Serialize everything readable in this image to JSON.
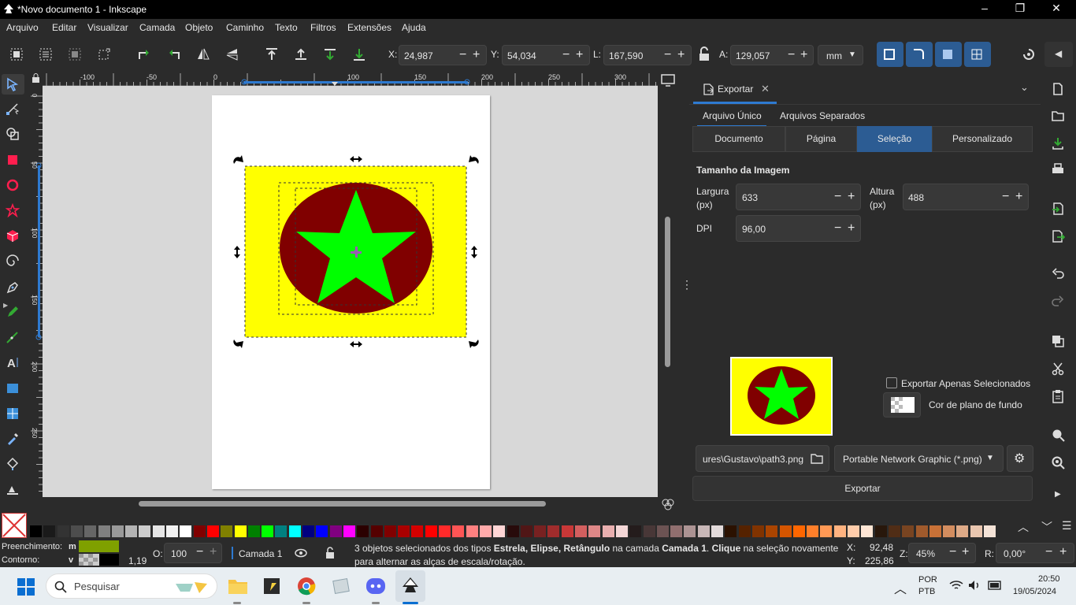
{
  "window": {
    "title": "*Novo documento 1 - Inkscape"
  },
  "menu": [
    "Arquivo",
    "Editar",
    "Visualizar",
    "Camada",
    "Objeto",
    "Caminho",
    "Texto",
    "Filtros",
    "Extensões",
    "Ajuda"
  ],
  "toolbar": {
    "x_label": "X:",
    "x_value": "24,987",
    "y_label": "Y:",
    "y_value": "54,034",
    "w_label": "L:",
    "w_value": "167,590",
    "h_label": "A:",
    "h_value": "129,057",
    "unit": "mm"
  },
  "rulers": {
    "h_ticks": [
      "-100",
      "-50",
      "0",
      "50",
      "100",
      "150",
      "200",
      "250",
      "300"
    ],
    "v_ticks": [
      "0",
      "50",
      "100",
      "150",
      "200",
      "250"
    ]
  },
  "export_panel": {
    "tab_title": "Exportar",
    "subtabs": [
      "Arquivo Único",
      "Arquivos Separados"
    ],
    "modes": [
      "Documento",
      "Página",
      "Seleção",
      "Personalizado"
    ],
    "active_mode": "Seleção",
    "section_title": "Tamanho da Imagem",
    "width_label": "Largura (px)",
    "width_value": "633",
    "height_label": "Altura (px)",
    "height_value": "488",
    "dpi_label": "DPI",
    "dpi_value": "96,00",
    "only_selected_label": "Exportar Apenas Selecionados",
    "bg_color_label": "Cor de plano de fundo",
    "filename": "ures\\Gustavo\\path3.png",
    "format": "Portable Network Graphic (*.png)",
    "export_button": "Exportar"
  },
  "colors": {
    "rect_fill": "#ffff00",
    "ellipse_fill": "#800000",
    "star_fill": "#00ff00",
    "accent": "#2c5c93"
  },
  "palette": [
    "#000000",
    "#1a1a1a",
    "#333333",
    "#4d4d4d",
    "#666666",
    "#808080",
    "#999999",
    "#b3b3b3",
    "#cccccc",
    "#e6e6e6",
    "#f2f2f2",
    "#ffffff",
    "#800000",
    "#ff0000",
    "#808000",
    "#ffff00",
    "#008000",
    "#00ff00",
    "#008080",
    "#00ffff",
    "#000080",
    "#0000ff",
    "#800080",
    "#ff00ff",
    "#2b0000",
    "#550000",
    "#800000",
    "#aa0000",
    "#d40000",
    "#ff0000",
    "#ff2a2a",
    "#ff5555",
    "#ff8080",
    "#ffaaaa",
    "#ffd5d5",
    "#280b0b",
    "#501616",
    "#782121",
    "#a02c2c",
    "#c83737",
    "#d35f5f",
    "#de8787",
    "#e9afaf",
    "#f4d7d7",
    "#241c1c",
    "#483737",
    "#6c5353",
    "#916f6f",
    "#ac9393",
    "#c8b7b7",
    "#e3dbdb",
    "#2b1100",
    "#552200",
    "#803300",
    "#aa4400",
    "#d45500",
    "#ff6600",
    "#ff7f2a",
    "#ff9955",
    "#ffb380",
    "#ffccaa",
    "#ffe6d5",
    "#28170b",
    "#502d16",
    "#784421",
    "#a05a2c",
    "#c87137",
    "#d38d5f",
    "#deaa87",
    "#e9c6af",
    "#f4e3d7"
  ],
  "status": {
    "fill_label": "Preenchimento:",
    "fill_code": "m",
    "stroke_label": "Contorno:",
    "stroke_code": "v",
    "stroke_width": "1,19",
    "opacity_label": "O:",
    "opacity_value": "100",
    "layer": "Camada 1",
    "message_a": "3 objetos selecionados dos tipos ",
    "message_b": "Estrela, Elipse, Retângulo",
    "message_c": " na camada ",
    "message_d": "Camada 1",
    "message_e": ". ",
    "message_f": "Clique",
    "message_g": " na seleção novamente para alternar as alças de escala/rotação.",
    "cursor_x_label": "X:",
    "cursor_x": "92,48",
    "cursor_y_label": "Y:",
    "cursor_y": "225,86",
    "zoom_label": "Z:",
    "zoom_value": "45%",
    "rotation_label": "R:",
    "rotation_value": "0,00°",
    "fill_color": "#7fa000"
  },
  "taskbar": {
    "search_placeholder": "Pesquisar",
    "lang1": "POR",
    "lang2": "PTB",
    "time": "20:50",
    "date": "19/05/2024"
  }
}
